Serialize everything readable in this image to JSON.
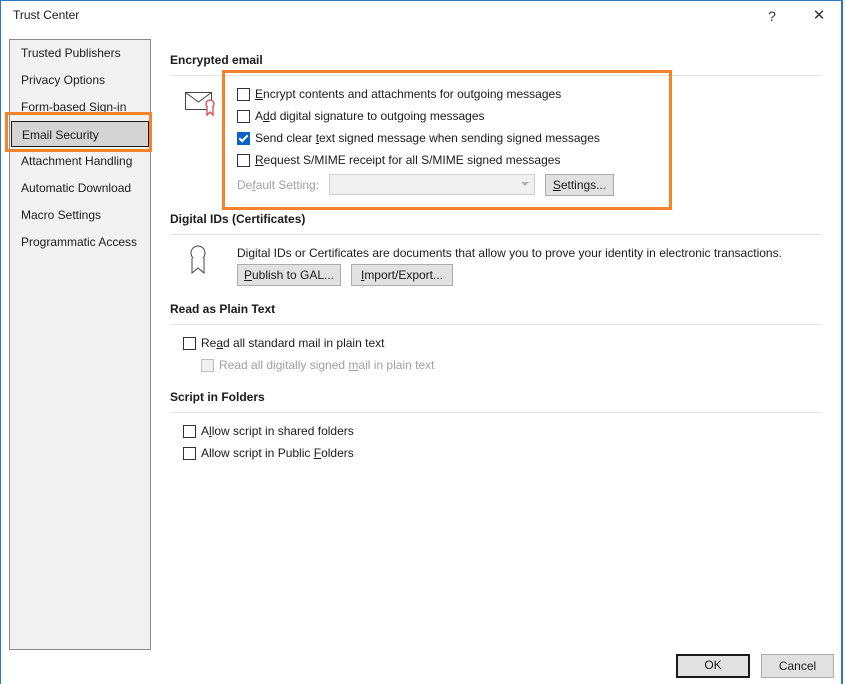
{
  "window": {
    "title": "Trust Center",
    "help_label": "?",
    "close_label": "✕"
  },
  "sidebar": {
    "items": [
      {
        "label": "Trusted Publishers",
        "selected": false
      },
      {
        "label": "Privacy Options",
        "selected": false
      },
      {
        "label": "Form-based Sign-in",
        "selected": false
      },
      {
        "label": "Email Security",
        "selected": true
      },
      {
        "label": "Attachment Handling",
        "selected": false
      },
      {
        "label": "Automatic Download",
        "selected": false
      },
      {
        "label": "Macro Settings",
        "selected": false
      },
      {
        "label": "Programmatic Access",
        "selected": false
      }
    ]
  },
  "encrypted_email": {
    "title": "Encrypted email",
    "options": [
      {
        "pre": "",
        "key": "E",
        "post": "ncrypt contents and attachments for outgoing messages",
        "checked": false
      },
      {
        "pre": "A",
        "key": "d",
        "post": "d digital signature to outgoing messages",
        "checked": false
      },
      {
        "pre": "Send clear ",
        "key": "t",
        "post": "ext signed message when sending signed messages",
        "checked": true
      },
      {
        "pre": "",
        "key": "R",
        "post": "equest S/MIME receipt for all S/MIME signed messages",
        "checked": false
      }
    ],
    "default_setting": {
      "pre": "De",
      "key": "f",
      "post": "ault Setting:",
      "value": "",
      "disabled": true
    },
    "settings_button": {
      "pre": "",
      "key": "S",
      "post": "ettings..."
    }
  },
  "digital_ids": {
    "title": "Digital IDs (Certificates)",
    "description": "Digital IDs or Certificates are documents that allow you to prove your identity in electronic transactions.",
    "publish_button": {
      "pre": "",
      "key": "P",
      "post": "ublish to GAL..."
    },
    "import_export_button": {
      "pre": "",
      "key": "I",
      "post": "mport/Export..."
    }
  },
  "plain_text": {
    "title": "Read as Plain Text",
    "options": [
      {
        "pre": "Re",
        "key": "a",
        "post": "d all standard mail in plain text",
        "checked": false,
        "disabled": false
      },
      {
        "pre": "Read all digitally signed ",
        "key": "m",
        "post": "ail in plain text",
        "checked": false,
        "disabled": true
      }
    ]
  },
  "script_folders": {
    "title": "Script in Folders",
    "options": [
      {
        "pre": "A",
        "key": "l",
        "post": "low script in shared folders",
        "checked": false
      },
      {
        "pre": "Allow script in Public ",
        "key": "F",
        "post": "olders",
        "checked": false
      }
    ]
  },
  "footer": {
    "ok_label": "OK",
    "cancel_label": "Cancel"
  },
  "colors": {
    "highlight": "#f5832a",
    "checkbox_checked": "#0a64c8",
    "window_border": "#2b79c2"
  }
}
